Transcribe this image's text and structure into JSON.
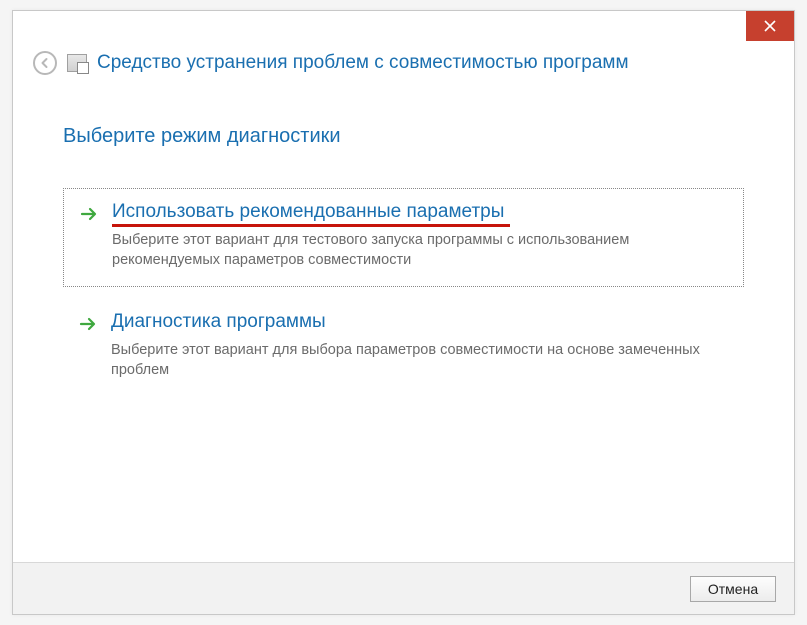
{
  "window": {
    "title": "Средство устранения проблем с совместимостью программ"
  },
  "content": {
    "subtitle": "Выберите режим диагностики",
    "options": [
      {
        "title": "Использовать рекомендованные параметры",
        "description": "Выберите этот вариант для тестового запуска программы с использованием рекомендуемых параметров совместимости"
      },
      {
        "title": "Диагностика программы",
        "description": "Выберите этот вариант для выбора параметров совместимости на основе замеченных проблем"
      }
    ]
  },
  "footer": {
    "cancel": "Отмена"
  }
}
